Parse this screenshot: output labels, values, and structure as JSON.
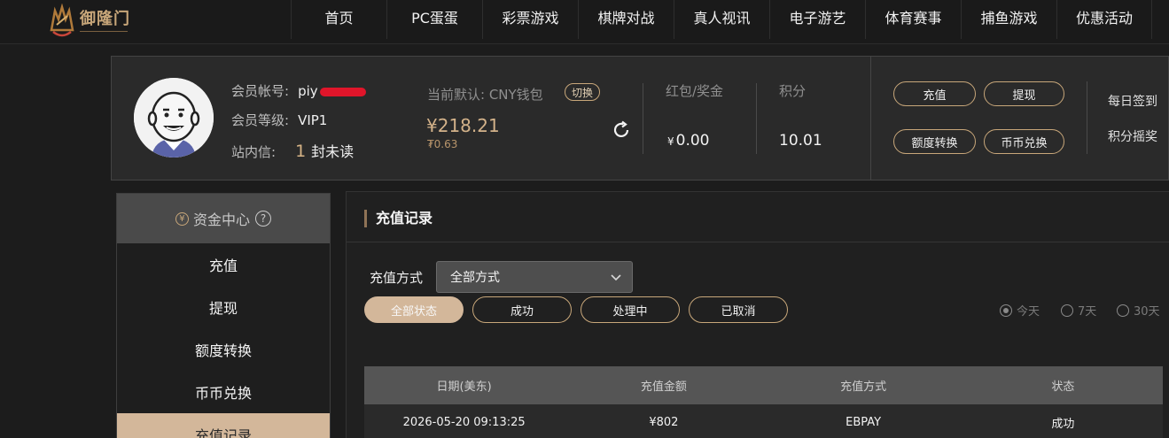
{
  "header": {
    "logo_text": "御隆门",
    "nav": [
      "首页",
      "PC蛋蛋",
      "彩票游戏",
      "棋牌对战",
      "真人视讯",
      "电子游艺",
      "体育赛事",
      "捕鱼游戏",
      "优惠活动"
    ]
  },
  "member": {
    "account_label": "会员帐号:",
    "account_value": "piy",
    "level_label": "会员等级:",
    "level_value": "VIP1",
    "message_label": "站内信:",
    "message_count": "1",
    "message_unit": "封未读"
  },
  "wallet": {
    "label": "当前默认: CNY钱包",
    "switch_label": "切换",
    "balance": "¥218.21",
    "sub_balance": "₮0.63"
  },
  "stats": {
    "bonus_label": "红包/奖金",
    "bonus_currency": "¥",
    "bonus_value": "0.00",
    "points_label": "积分",
    "points_value": "10.01"
  },
  "actions": {
    "deposit": "充值",
    "withdraw": "提现",
    "transfer": "额度转换",
    "exchange": "币币兑换",
    "daily_signin": "每日签到",
    "points_shake": "积分摇奖"
  },
  "sidebar": {
    "title": "资金中心",
    "coin_glyph": "¥",
    "help_glyph": "?",
    "items": [
      "充值",
      "提现",
      "额度转换",
      "币币兑换",
      "充值记录"
    ],
    "active_index": 4
  },
  "main": {
    "title": "充值记录",
    "filter_label": "充值方式",
    "filter_value": "全部方式",
    "status_tabs": [
      "全部状态",
      "成功",
      "处理中",
      "已取消"
    ],
    "range_options": [
      "今天",
      "7天",
      "30天"
    ],
    "range_selected": "今天"
  },
  "table": {
    "columns": [
      "日期(美东)",
      "充值金额",
      "充值方式",
      "状态"
    ],
    "rows": [
      [
        "2026-05-20 09:13:25",
        "¥802",
        "EBPAY",
        "成功"
      ]
    ]
  },
  "colors": {
    "accent": "#c8a77a",
    "active_bg": "#d3b79a",
    "panel_bg": "#2a2a2a",
    "page_bg": "#1c1c1c"
  }
}
